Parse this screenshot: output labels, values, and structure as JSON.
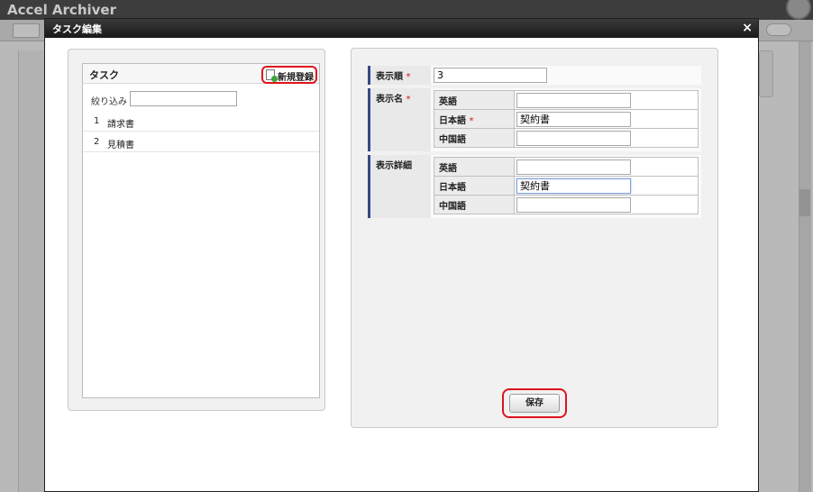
{
  "app": {
    "title": "Accel Archiver"
  },
  "dialog": {
    "title": "タスク編集",
    "close_label": "×"
  },
  "left": {
    "panel_title": "タスク",
    "new_button_label": "新規登録",
    "filter_label": "絞り込み",
    "filter_value": "",
    "tasks": [
      {
        "num": "1",
        "name": "請求書"
      },
      {
        "num": "2",
        "name": "見積書"
      }
    ]
  },
  "form": {
    "order_label": "表示順",
    "order_value": "3",
    "display_name_label": "表示名",
    "display_detail_label": "表示詳細",
    "required_mark": "*",
    "lang_en": "英語",
    "lang_ja": "日本語",
    "lang_zh": "中国語",
    "name_en": "",
    "name_ja": "契約書",
    "name_zh": "",
    "detail_en": "",
    "detail_ja": "契約書",
    "detail_zh": "",
    "save_label": "保存"
  },
  "colors": {
    "highlight": "#e0141e",
    "label_accent": "#36498c",
    "required": "#d21414"
  }
}
